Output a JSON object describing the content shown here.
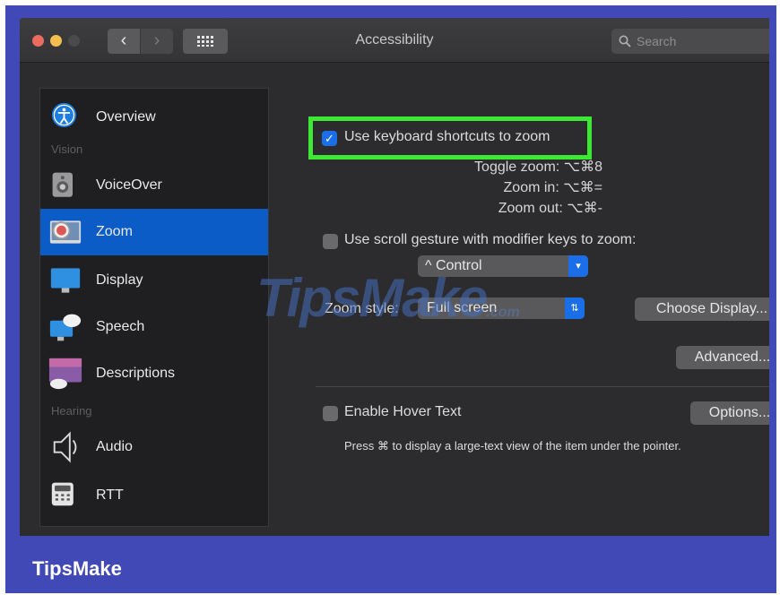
{
  "window": {
    "title": "Accessibility",
    "search_placeholder": "Search",
    "back_glyph": "‹",
    "forward_glyph": "›"
  },
  "sidebar": {
    "items": [
      {
        "label": "Overview",
        "icon": "accessibility-icon"
      },
      {
        "label": "VoiceOver",
        "icon": "voiceover-icon"
      },
      {
        "label": "Zoom",
        "icon": "zoom-icon",
        "selected": true
      },
      {
        "label": "Display",
        "icon": "display-icon"
      },
      {
        "label": "Speech",
        "icon": "speech-icon"
      },
      {
        "label": "Descriptions",
        "icon": "descriptions-icon"
      },
      {
        "label": "Audio",
        "icon": "audio-icon"
      },
      {
        "label": "RTT",
        "icon": "rtt-icon"
      }
    ],
    "headers": {
      "vision": "Vision",
      "hearing": "Hearing"
    }
  },
  "zoom": {
    "keyboard_shortcuts": {
      "label": "Use keyboard shortcuts to zoom",
      "checked": true
    },
    "shortcuts": {
      "toggle": "Toggle zoom:  ⌥⌘8",
      "zoom_in": "Zoom in:  ⌥⌘=",
      "zoom_out": "Zoom out:  ⌥⌘-"
    },
    "scroll_gesture": {
      "label": "Use scroll gesture with modifier keys to zoom:",
      "checked": false
    },
    "modifier_value": "^ Control",
    "zoom_style_label": "Zoom style:",
    "zoom_style_value": "Full screen",
    "choose_display_label": "Choose Display...",
    "advanced_label": "Advanced...",
    "hover_text": {
      "label": "Enable Hover Text",
      "checked": false
    },
    "options_label": "Options...",
    "hover_description": "Press ⌘ to display a large-text view of the item under the pointer."
  },
  "watermark": {
    "text": "TipsMake",
    "suffix": ".com"
  },
  "brand": "TipsMake",
  "colors": {
    "frame": "#4149b7",
    "selection": "#0b5cc7",
    "highlight": "#3de835",
    "window_bg": "#2c2c2e"
  }
}
